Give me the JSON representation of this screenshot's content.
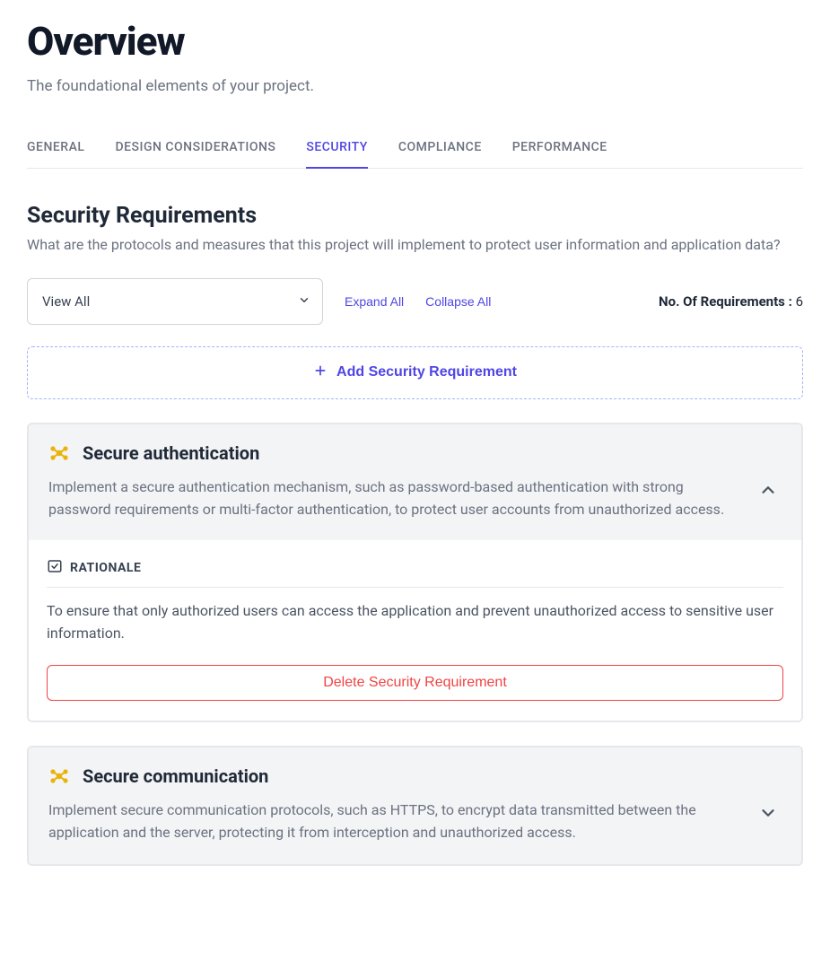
{
  "page": {
    "title": "Overview",
    "subtitle": "The foundational elements of your project."
  },
  "tabs": [
    {
      "label": "GENERAL",
      "active": false
    },
    {
      "label": "DESIGN CONSIDERATIONS",
      "active": false
    },
    {
      "label": "SECURITY",
      "active": true
    },
    {
      "label": "COMPLIANCE",
      "active": false
    },
    {
      "label": "PERFORMANCE",
      "active": false
    }
  ],
  "section": {
    "title": "Security Requirements",
    "description": "What are the protocols and measures that this project will implement to protect user information and application data?"
  },
  "filter": {
    "selected": "View All"
  },
  "actions": {
    "expand_all": "Expand All",
    "collapse_all": "Collapse All",
    "add_label": "Add Security Requirement",
    "delete_label": "Delete Security Requirement"
  },
  "count": {
    "label": "No. Of Requirements :",
    "value": "6"
  },
  "rationale_heading": "RATIONALE",
  "requirements": [
    {
      "title": "Secure authentication",
      "description": "Implement a secure authentication mechanism, such as password-based authentication with strong password requirements or multi-factor authentication, to protect user accounts from unauthorized access.",
      "expanded": true,
      "rationale": "To ensure that only authorized users can access the application and prevent unauthorized access to sensitive user information."
    },
    {
      "title": "Secure communication",
      "description": "Implement secure communication protocols, such as HTTPS, to encrypt data transmitted between the application and the server, protecting it from interception and unauthorized access.",
      "expanded": false
    }
  ]
}
